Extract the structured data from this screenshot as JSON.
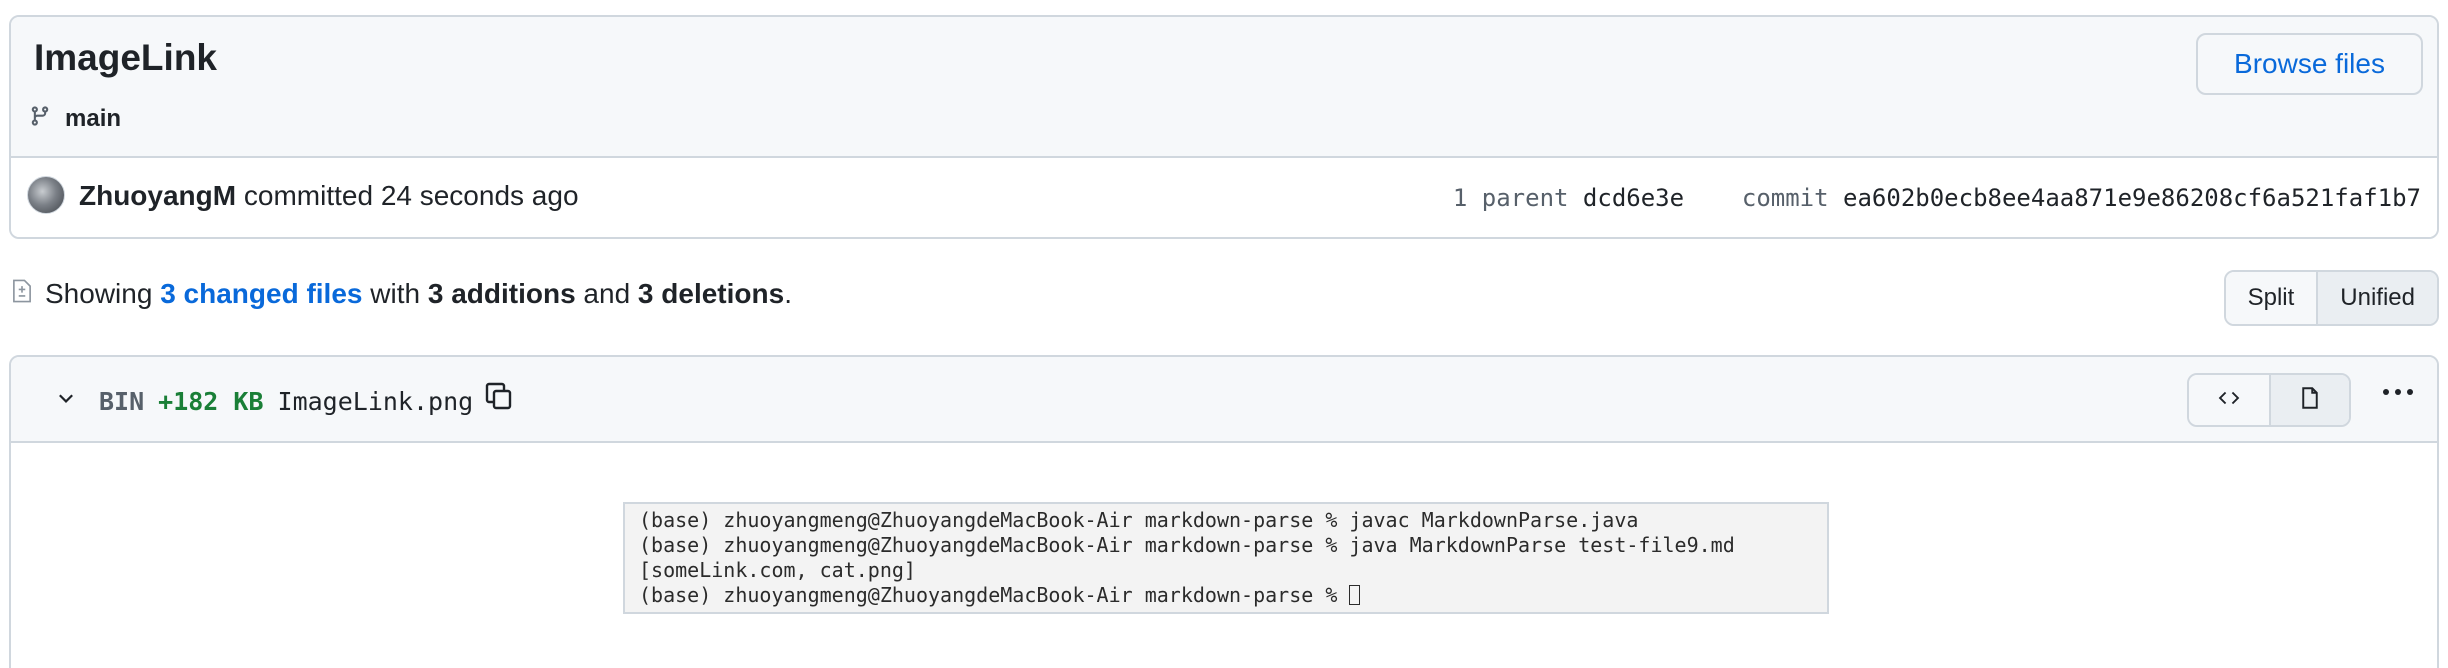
{
  "commit": {
    "title": "ImageLink",
    "branch": "main",
    "browse_label": "Browse files",
    "author": "ZhuoyangM",
    "action": "committed",
    "time": "24 seconds ago",
    "parent_label": "1 parent",
    "parent_sha": "dcd6e3e",
    "commit_label": "commit",
    "commit_sha": "ea602b0ecb8ee4aa871e9e86208cf6a521faf1b7"
  },
  "summary": {
    "showing": "Showing",
    "changed_files": "3 changed files",
    "with": "with",
    "additions": "3 additions",
    "and": "and",
    "deletions": "3 deletions",
    "period": "."
  },
  "view_toggle": {
    "split": "Split",
    "unified": "Unified",
    "selected": "Unified"
  },
  "file": {
    "type": "BIN",
    "size_change": "+182 KB",
    "name": "ImageLink.png"
  },
  "preview": {
    "lines": [
      "(base) zhuoyangmeng@ZhuoyangdeMacBook-Air markdown-parse % javac MarkdownParse.java",
      "(base) zhuoyangmeng@ZhuoyangdeMacBook-Air markdown-parse % java MarkdownParse test-file9.md",
      "[someLink.com, cat.png]",
      "(base) zhuoyangmeng@ZhuoyangdeMacBook-Air markdown-parse % "
    ]
  },
  "colors": {
    "link": "#0969da",
    "additions": "#1a7f37",
    "border": "#d0d7de",
    "header_bg": "#f6f8fa"
  }
}
